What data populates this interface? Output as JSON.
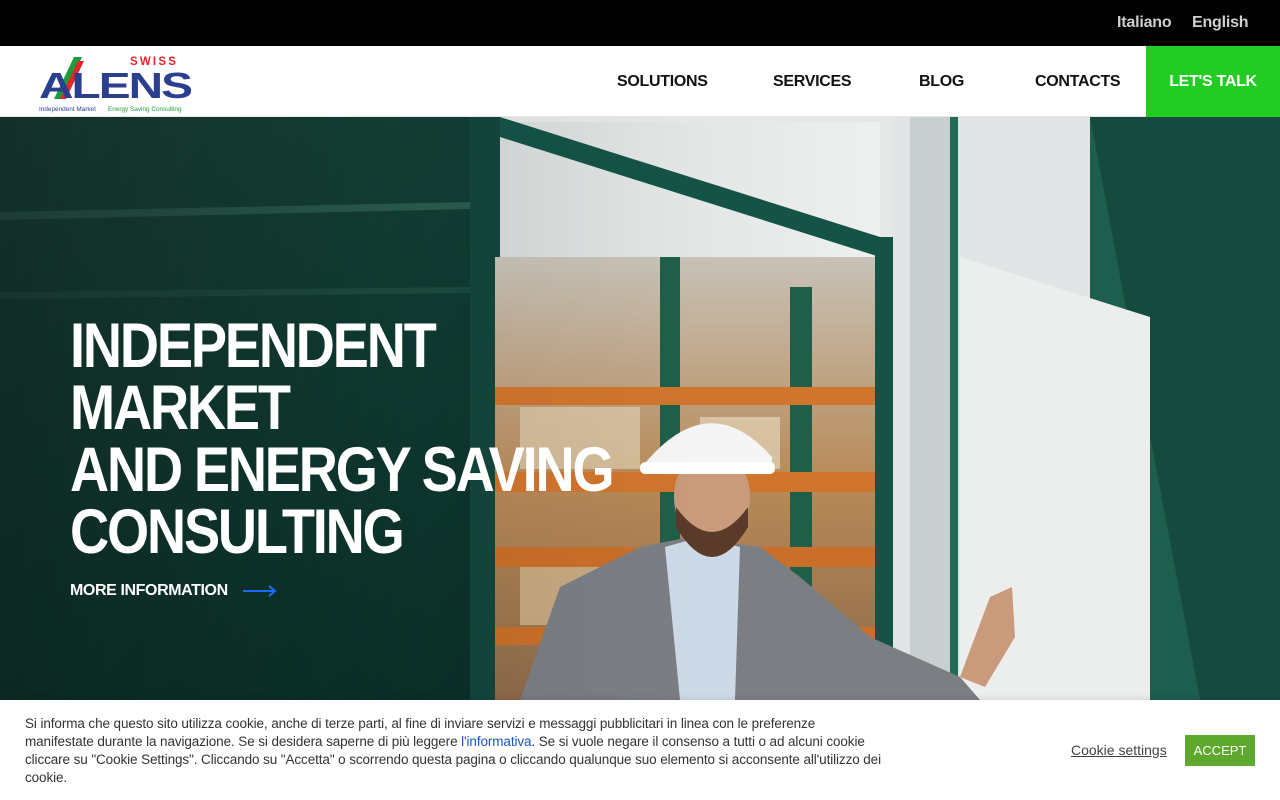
{
  "topbar": {
    "languages": [
      "Italiano",
      "English"
    ]
  },
  "header": {
    "logo": {
      "brand_top": "SWISS",
      "brand_main": "ALENS",
      "tagline_left": "Independent Market",
      "tagline_right": "Energy Saving Consulting"
    },
    "nav": [
      "SOLUTIONS",
      "SERVICES",
      "BLOG",
      "CONTACTS"
    ],
    "cta_label": "LET'S TALK"
  },
  "hero": {
    "title": "INDEPENDENT MARKET\nAND ENERGY SAVING\nCONSULTING",
    "more_info_label": "MORE INFORMATION"
  },
  "cookie": {
    "text_before_link": "Si informa che questo sito utilizza cookie, anche di terze parti, al fine di inviare servizi e messaggi pubblicitari in linea con le preferenze manifestate durante la navigazione. Se si desidera saperne di più leggere ",
    "link_label": "l'informativa",
    "text_after_link": ". Se si vuole negare il consenso a tutti o ad alcuni cookie cliccare su \"Cookie Settings\". Cliccando su \"Accetta\" o scorrendo questa pagina o cliccando qualunque suo elemento si acconsente all'utilizzo dei cookie.",
    "settings_label": "Cookie settings",
    "accept_label": "ACCEPT"
  },
  "colors": {
    "accent_green": "#22cc22",
    "accept_green": "#5ea82e",
    "logo_blue": "#2b3f8f",
    "logo_red": "#e4262c",
    "logo_green": "#1d9b3a"
  }
}
